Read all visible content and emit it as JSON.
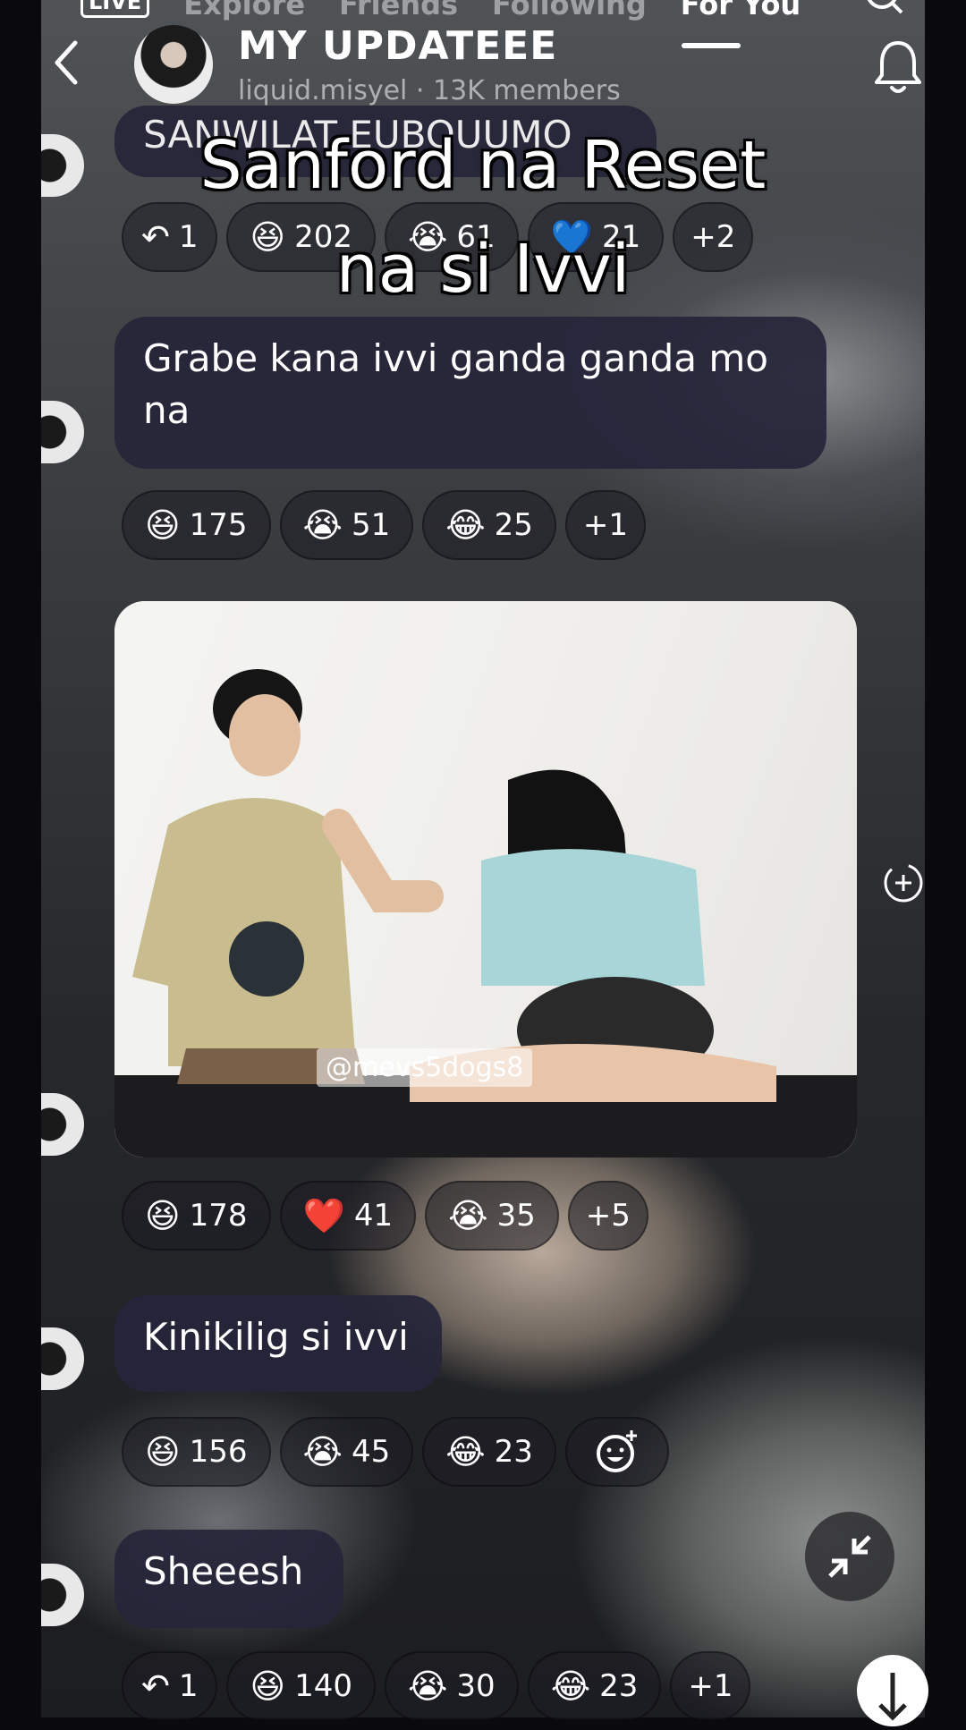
{
  "topnav": {
    "live": "LIVE",
    "tabs": [
      "Explore",
      "Friends",
      "Following",
      "For You"
    ]
  },
  "header": {
    "group_name": "MY UPDATEEE",
    "owner": "liquid.misyel",
    "members": "· 13K members"
  },
  "caption": {
    "line1": "Sanford na Reset",
    "line2": "na si Ivvi"
  },
  "messages": [
    {
      "text": "SANWILAT EUBOUUMO",
      "reactions": [
        {
          "icon": "reply-arrow-icon",
          "glyph": "↶",
          "count": "1"
        },
        {
          "icon": "laughing-emoji-icon",
          "glyph": "😆",
          "count": "202"
        },
        {
          "icon": "crying-emoji-icon",
          "glyph": "😭",
          "count": "61"
        },
        {
          "icon": "blue-heart-icon",
          "glyph": "💙",
          "count": "21"
        },
        {
          "icon": "more-reactions",
          "glyph": "",
          "count": "+2"
        }
      ]
    },
    {
      "text": "Grabe kana ivvi ganda ganda mo na",
      "reactions": [
        {
          "icon": "laughing-emoji-icon",
          "glyph": "😆",
          "count": "175"
        },
        {
          "icon": "crying-emoji-icon",
          "glyph": "😭",
          "count": "51"
        },
        {
          "icon": "tears-of-joy-emoji-icon",
          "glyph": "😂",
          "count": "25"
        },
        {
          "icon": "more-reactions",
          "glyph": "",
          "count": "+1"
        }
      ]
    },
    {
      "watermark": "@mevs5dogs8",
      "reactions": [
        {
          "icon": "laughing-emoji-icon",
          "glyph": "😆",
          "count": "178"
        },
        {
          "icon": "red-heart-icon",
          "glyph": "❤️",
          "count": "41"
        },
        {
          "icon": "crying-emoji-icon",
          "glyph": "😭",
          "count": "35"
        },
        {
          "icon": "more-reactions",
          "glyph": "",
          "count": "+5"
        }
      ]
    },
    {
      "text": "Kinikilig si ivvi",
      "reactions": [
        {
          "icon": "laughing-emoji-icon",
          "glyph": "😆",
          "count": "156"
        },
        {
          "icon": "crying-emoji-icon",
          "glyph": "😭",
          "count": "45"
        },
        {
          "icon": "tears-of-joy-emoji-icon",
          "glyph": "😂",
          "count": "23"
        },
        {
          "icon": "add-reaction-icon",
          "glyph": "",
          "count": ""
        }
      ]
    },
    {
      "text": "Sheeesh",
      "reactions": [
        {
          "icon": "reply-arrow-icon",
          "glyph": "↶",
          "count": "1"
        },
        {
          "icon": "laughing-emoji-icon",
          "glyph": "😆",
          "count": "140"
        },
        {
          "icon": "crying-emoji-icon",
          "glyph": "😭",
          "count": "30"
        },
        {
          "icon": "tears-of-joy-emoji-icon",
          "glyph": "😂",
          "count": "23"
        },
        {
          "icon": "more-reactions",
          "glyph": "",
          "count": "+1"
        }
      ]
    }
  ]
}
